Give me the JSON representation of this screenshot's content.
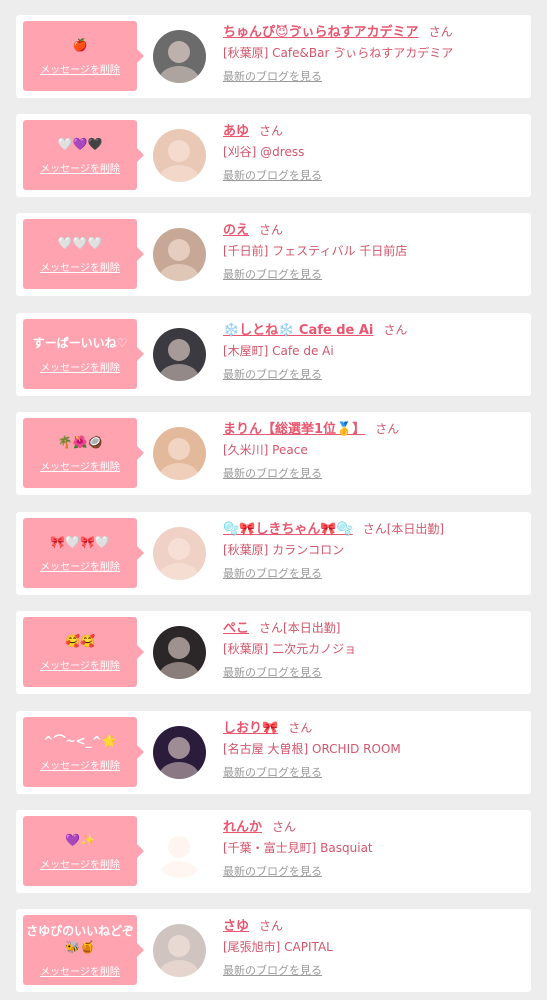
{
  "cards": [
    {
      "message": "🍎",
      "delete_label": "メッセージを削除",
      "name": "ちゅんぴ😈ゔぃらねすアカデミア",
      "suffix": "さん",
      "shop": "[秋葉原] Cafe&Bar ゔぃらねすアカデミア",
      "blog_label": "最新のブログを見る"
    },
    {
      "message": "🤍💜🖤",
      "delete_label": "メッセージを削除",
      "name": "あゆ",
      "suffix": "さん",
      "shop": "[刈谷] @dress",
      "blog_label": "最新のブログを見る"
    },
    {
      "message": "🤍🤍🤍",
      "delete_label": "メッセージを削除",
      "name": "のえ",
      "suffix": "さん",
      "shop": "[千日前] フェスティバル 千日前店",
      "blog_label": "最新のブログを見る"
    },
    {
      "message": "すーぱーいいね♡",
      "delete_label": "メッセージを削除",
      "name": "❄️しとね❄️ Cafe de Ai",
      "suffix": "さん",
      "shop": "[木屋町] Cafe de Ai",
      "blog_label": "最新のブログを見る"
    },
    {
      "message": "🌴🌺🥥",
      "delete_label": "メッセージを削除",
      "name": "まりん【総選挙1位🥇】",
      "suffix": "さん",
      "shop": "[久米川] Peace",
      "blog_label": "最新のブログを見る"
    },
    {
      "message": "🎀🤍🎀🤍",
      "delete_label": "メッセージを削除",
      "name": "🫧🎀しきちゃん🎀🫧",
      "suffix": "さん[本日出勤]",
      "shop": "[秋葉原] カランコロン",
      "blog_label": "最新のブログを見る"
    },
    {
      "message": "🥰🥰",
      "delete_label": "メッセージを削除",
      "name": "ぺこ",
      "suffix": "さん[本日出勤]",
      "shop": "[秋葉原] 二次元カノジョ",
      "blog_label": "最新のブログを見る"
    },
    {
      "message": "^⌒~<_^🌟",
      "delete_label": "メッセージを削除",
      "name": "しおり🎀",
      "suffix": "さん",
      "shop": "[名古屋 大曽根] ORCHID ROOM",
      "blog_label": "最新のブログを見る"
    },
    {
      "message": "💜✨",
      "delete_label": "メッセージを削除",
      "name": "れんか",
      "suffix": "さん",
      "shop": "[千葉・富士見町] Basquiat",
      "blog_label": "最新のブログを見る"
    },
    {
      "message": "さゆぴのいいねどぞ🐝🍯",
      "delete_label": "メッセージを削除",
      "name": "さゆ",
      "suffix": "さん",
      "shop": "[尾張旭市] CAPITAL",
      "blog_label": "最新のブログを見る"
    }
  ],
  "colors": {
    "accent": "#e8566f",
    "bubble": "#ffa3b1",
    "background": "#ededed"
  },
  "icons": [
    "profile-photo"
  ]
}
